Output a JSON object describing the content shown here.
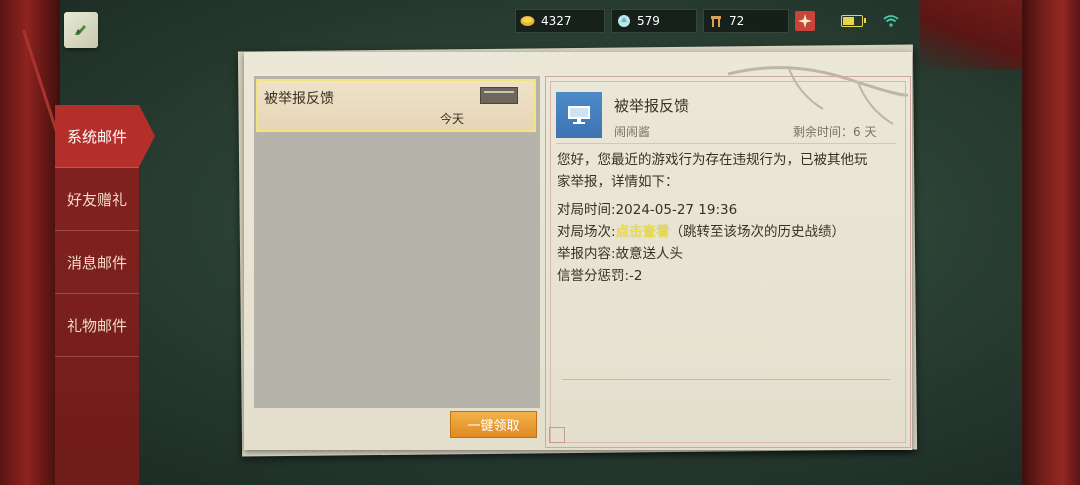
{
  "status_bar": {
    "gold": "4327",
    "gems": "579",
    "tickets": "72"
  },
  "sidebar": {
    "items": [
      {
        "label": "系统邮件"
      },
      {
        "label": "好友赠礼"
      },
      {
        "label": "消息邮件"
      },
      {
        "label": "礼物邮件"
      }
    ]
  },
  "mail_list": {
    "items": [
      {
        "title": "被举报反馈",
        "date": "今天"
      }
    ],
    "claim_all_label": "一键领取"
  },
  "detail": {
    "title": "被举报反馈",
    "sender": "闹闹酱",
    "remaining": "剩余时间：6 天",
    "intro_line1": "您好，您最近的游戏行为存在违规行为，已被其他玩",
    "intro_line2": "家举报，详情如下：",
    "match_time": "对局时间:2024-05-27 19:36",
    "match_label": "对局场次:",
    "match_link": "点击查看",
    "match_hint": "（跳转至该场次的历史战绩）",
    "report_content": "举报内容:故意送人头",
    "credit_penalty": "信誉分惩罚:-2"
  },
  "colors": {
    "accent_red": "#b52f2a",
    "link_yellow": "#f5e64a",
    "button_orange": "#e08a22",
    "sender_icon_blue": "#3d74b3"
  }
}
